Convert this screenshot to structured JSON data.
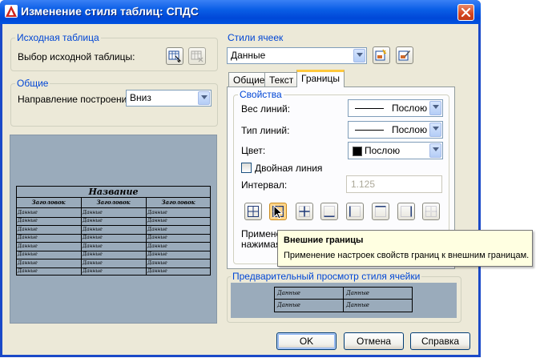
{
  "window": {
    "title": "Изменение стиля таблиц: СПДС"
  },
  "source_table": {
    "group_title": "Исходная таблица",
    "select_label": "Выбор исходной таблицы:"
  },
  "general": {
    "group_title": "Общие",
    "direction_label": "Направление построения:",
    "direction_value": "Вниз"
  },
  "preview": {
    "title": "Название",
    "header_cell": "Заголовок",
    "data_cell": "Данные"
  },
  "cell_styles": {
    "group_title": "Стили ячеек",
    "style_value": "Данные"
  },
  "tabs": [
    {
      "label": "Общие"
    },
    {
      "label": "Текст"
    },
    {
      "label": "Границы"
    }
  ],
  "properties": {
    "group_title": "Свойства",
    "line_weight_label": "Вес линий:",
    "line_weight_value": "Послою",
    "line_type_label": "Тип линий:",
    "line_type_value": "Послою",
    "color_label": "Цвет:",
    "color_value": "Послою",
    "color_swatch": "#000000",
    "double_line_label": "Двойная линия",
    "double_line_checked": false,
    "interval_label": "Интервал:",
    "interval_value": "1.125",
    "apply_text_1": "Примене",
    "apply_text_2": "нажимая"
  },
  "border_buttons": [
    {
      "icon": "all-borders-icon",
      "selected": false
    },
    {
      "icon": "outside-borders-icon",
      "selected": true
    },
    {
      "icon": "inside-borders-icon",
      "selected": false
    },
    {
      "icon": "bottom-border-icon",
      "selected": false
    },
    {
      "icon": "left-border-icon",
      "selected": false
    },
    {
      "icon": "top-border-icon",
      "selected": false
    },
    {
      "icon": "right-border-icon",
      "selected": false
    },
    {
      "icon": "no-border-icon",
      "selected": false
    }
  ],
  "tooltip": {
    "title": "Внешние границы",
    "text": "Применение настроек свойств границ к внешним границам."
  },
  "cell_preview": {
    "group_title": "Предварительный просмотр стиля ячейки",
    "cell": "Данные"
  },
  "buttons": {
    "ok": "OK",
    "cancel": "Отмена",
    "help": "Справка"
  },
  "colors": {
    "title_bar": "#0a5ee6",
    "dialog_bg": "#ece9d8",
    "preview_bg": "#9aabbb",
    "group_title_text": "#0046d5"
  }
}
